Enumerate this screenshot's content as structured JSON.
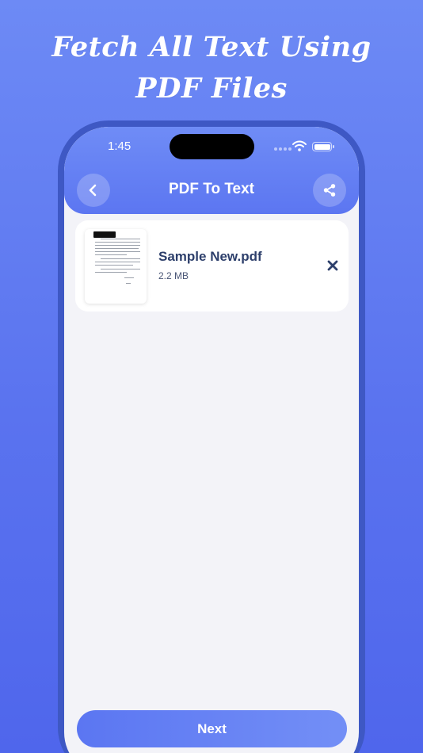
{
  "promo": {
    "headline_line1": "Fetch All Text Using",
    "headline_line2": "PDF Files"
  },
  "status_bar": {
    "time": "1:45"
  },
  "header": {
    "title": "PDF To Text",
    "back_icon": "chevron-left-icon",
    "share_icon": "share-icon"
  },
  "files": [
    {
      "name": "Sample New.pdf",
      "size": "2.2 MB",
      "remove_icon": "close-icon"
    }
  ],
  "footer": {
    "next_label": "Next"
  },
  "colors": {
    "background_top": "#6d8af5",
    "background_bottom": "#4f66ec",
    "header": "#6380f3",
    "frame": "#3e58c4",
    "screen": "#f3f3f8",
    "file_name": "#2d3f6b"
  }
}
